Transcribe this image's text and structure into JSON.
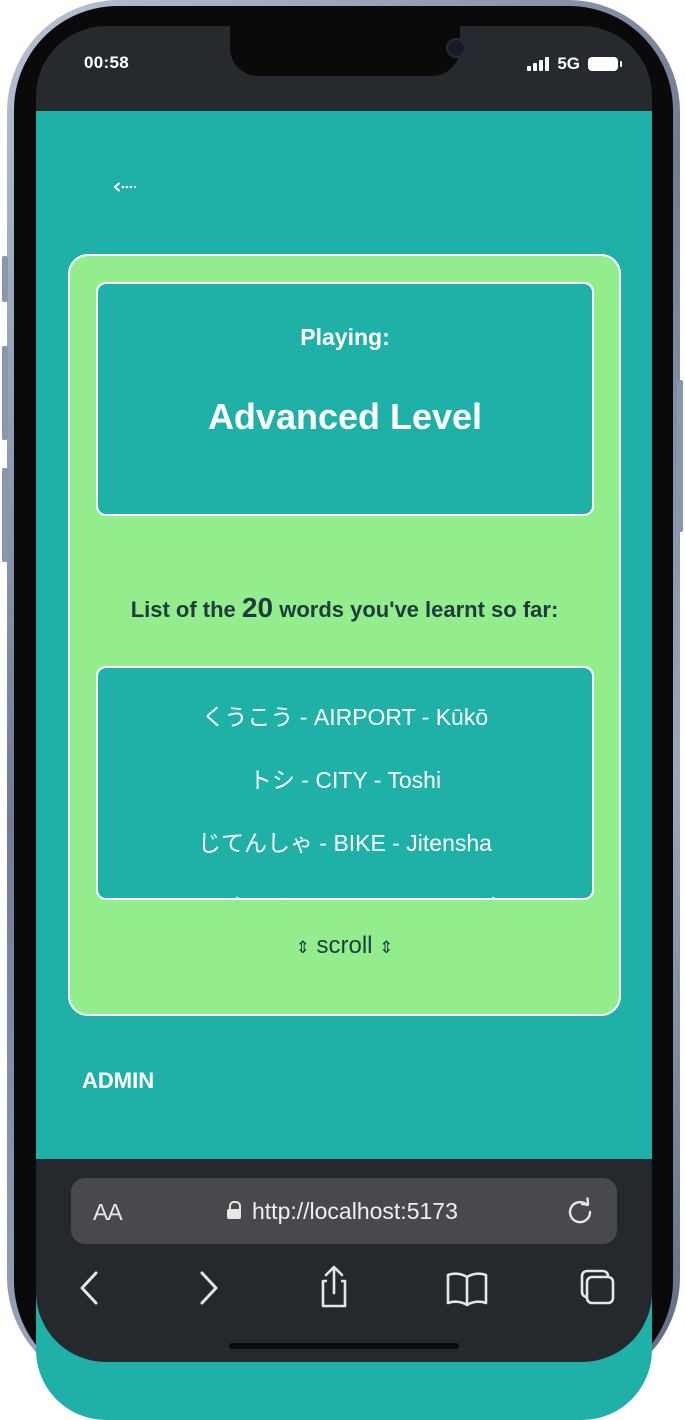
{
  "status_bar": {
    "time": "00:58",
    "network": "5G"
  },
  "page": {
    "back_link": "⇠",
    "playing_label": "Playing:",
    "level_name": "Advanced Level",
    "learnt_prefix": "List of the",
    "learnt_count": "20",
    "learnt_suffix": "words you've learnt so far:",
    "words": [
      "くうこう - AIRPORT - Kūkō",
      "トシ - CITY - Toshi",
      "じてんしゃ - BIKE - Jitensha",
      "ファッション - FASHION - Fasshon"
    ],
    "scroll_arrow": "⇕",
    "scroll_label": "scroll",
    "admin_link": "ADMIN"
  },
  "browser": {
    "text_size_label": "AA",
    "url": "http://localhost:5173",
    "icons": [
      "lock-icon",
      "reload-icon",
      "back-arrow-icon",
      "forward-arrow-icon",
      "share-icon",
      "bookmarks-icon",
      "tabs-icon"
    ]
  },
  "colors": {
    "page_background": "#1fb1a8",
    "card_background": "#93ed8c",
    "heading_text": "#1f3b3d",
    "browser_chrome": "#25282c"
  }
}
